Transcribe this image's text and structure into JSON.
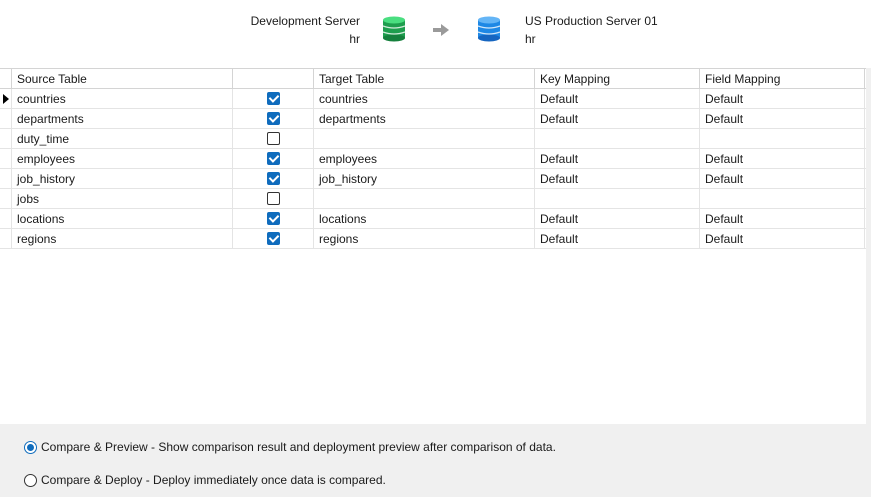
{
  "header": {
    "source_server": "Development Server",
    "source_db": "hr",
    "target_server": "US Production Server 01",
    "target_db": "hr",
    "source_icon": "database-green-icon",
    "target_icon": "database-blue-icon",
    "arrow_icon": "arrow-right-icon"
  },
  "grid": {
    "columns": [
      "Source Table",
      "",
      "Target Table",
      "Key Mapping",
      "Field Mapping"
    ],
    "rows": [
      {
        "source": "countries",
        "checked": true,
        "target": "countries",
        "key": "Default",
        "field": "Default",
        "current": true
      },
      {
        "source": "departments",
        "checked": true,
        "target": "departments",
        "key": "Default",
        "field": "Default",
        "current": false
      },
      {
        "source": "duty_time",
        "checked": false,
        "target": "",
        "key": "",
        "field": "",
        "current": false
      },
      {
        "source": "employees",
        "checked": true,
        "target": "employees",
        "key": "Default",
        "field": "Default",
        "current": false
      },
      {
        "source": "job_history",
        "checked": true,
        "target": "job_history",
        "key": "Default",
        "field": "Default",
        "current": false
      },
      {
        "source": "jobs",
        "checked": false,
        "target": "",
        "key": "",
        "field": "",
        "current": false
      },
      {
        "source": "locations",
        "checked": true,
        "target": "locations",
        "key": "Default",
        "field": "Default",
        "current": false
      },
      {
        "source": "regions",
        "checked": true,
        "target": "regions",
        "key": "Default",
        "field": "Default",
        "current": false
      }
    ]
  },
  "options": {
    "compare_preview": "Compare & Preview - Show comparison result and deployment preview after comparison of data.",
    "compare_deploy": "Compare & Deploy - Deploy immediately once data is compared.",
    "selected": "compare_preview"
  },
  "colors": {
    "accent": "#0f6cbd",
    "source_db": "#1e9e4e",
    "target_db": "#1e88e5"
  }
}
